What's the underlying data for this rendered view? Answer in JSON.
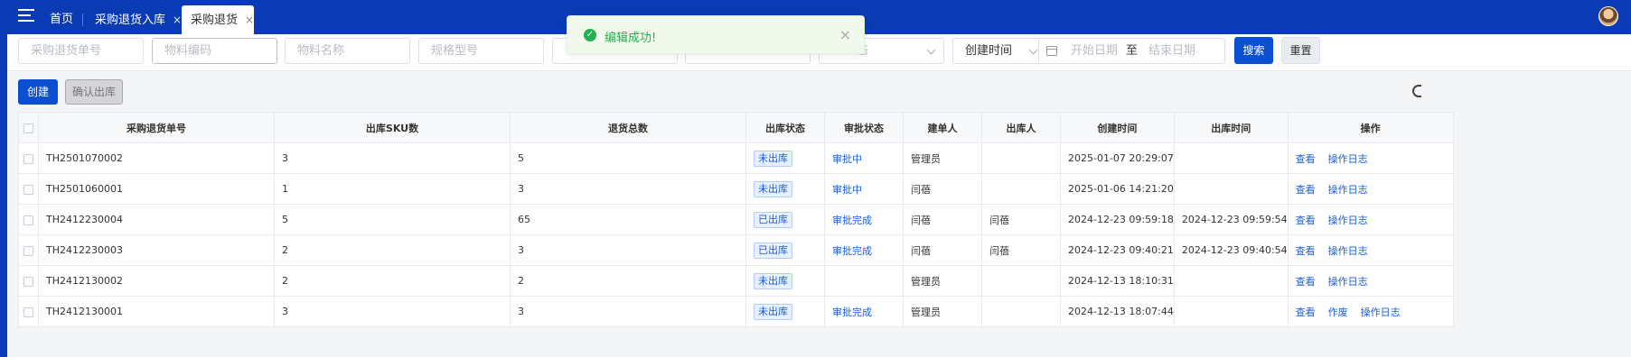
{
  "tabs": [
    {
      "label": "首页",
      "closable": false,
      "active": false
    },
    {
      "label": "采购退货入库",
      "closable": true,
      "active": false
    },
    {
      "label": "采购退货",
      "closable": true,
      "active": true
    }
  ],
  "tab_close_glyph": "×",
  "toast": {
    "message": "编辑成功!",
    "close_glyph": "×",
    "type": "success"
  },
  "filters": {
    "return_no_placeholder": "采购退货单号",
    "material_code_placeholder": "物料编码",
    "material_name_placeholder": "物料名称",
    "spec_placeholder": "规格型号",
    "status_partial": "态",
    "date_type": "创建时间",
    "start_date_placeholder": "开始日期",
    "range_separator": "至",
    "end_date_placeholder": "结束日期",
    "search_label": "搜索",
    "reset_label": "重置"
  },
  "actions": {
    "create_label": "创建",
    "confirm_label": "确认出库"
  },
  "table": {
    "columns": [
      "采购退货单号",
      "出库SKU数",
      "退货总数",
      "出库状态",
      "审批状态",
      "建单人",
      "出库人",
      "创建时间",
      "出库时间",
      "操作"
    ],
    "rows": [
      {
        "no": "TH2501070002",
        "sku": "3",
        "total": "5",
        "out_status": "未出库",
        "approval": "审批中",
        "creator": "管理员",
        "out_person": "",
        "created": "2025-01-07 20:29:07",
        "out_time": "",
        "ops": [
          "查看",
          "操作日志"
        ]
      },
      {
        "no": "TH2501060001",
        "sku": "1",
        "total": "3",
        "out_status": "未出库",
        "approval": "审批中",
        "creator": "闫蓓",
        "out_person": "",
        "created": "2025-01-06 14:21:20",
        "out_time": "",
        "ops": [
          "查看",
          "操作日志"
        ]
      },
      {
        "no": "TH2412230004",
        "sku": "5",
        "total": "65",
        "out_status": "已出库",
        "approval": "审批完成",
        "creator": "闫蓓",
        "out_person": "闫蓓",
        "created": "2024-12-23 09:59:18",
        "out_time": "2024-12-23 09:59:54",
        "ops": [
          "查看",
          "操作日志"
        ]
      },
      {
        "no": "TH2412230003",
        "sku": "2",
        "total": "3",
        "out_status": "已出库",
        "approval": "审批完成",
        "creator": "闫蓓",
        "out_person": "闫蓓",
        "created": "2024-12-23 09:40:21",
        "out_time": "2024-12-23 09:40:54",
        "ops": [
          "查看",
          "操作日志"
        ]
      },
      {
        "no": "TH2412130002",
        "sku": "2",
        "total": "2",
        "out_status": "未出库",
        "approval": "",
        "creator": "管理员",
        "out_person": "",
        "created": "2024-12-13 18:10:31",
        "out_time": "",
        "ops": [
          "查看",
          "操作日志"
        ]
      },
      {
        "no": "TH2412130001",
        "sku": "3",
        "total": "3",
        "out_status": "未出库",
        "approval": "审批完成",
        "creator": "管理员",
        "out_person": "",
        "created": "2024-12-13 18:07:44",
        "out_time": "",
        "ops": [
          "查看",
          "作废",
          "操作日志"
        ]
      }
    ]
  },
  "colors": {
    "brand": "#0a3bb5",
    "primary_button": "#0a4fd1",
    "success": "#22b14c",
    "link": "#1a5fd8"
  },
  "icons": [
    "menu-icon",
    "close-icon",
    "success-check-icon",
    "calendar-icon",
    "chevron-down-icon",
    "settings-icon",
    "avatar"
  ]
}
